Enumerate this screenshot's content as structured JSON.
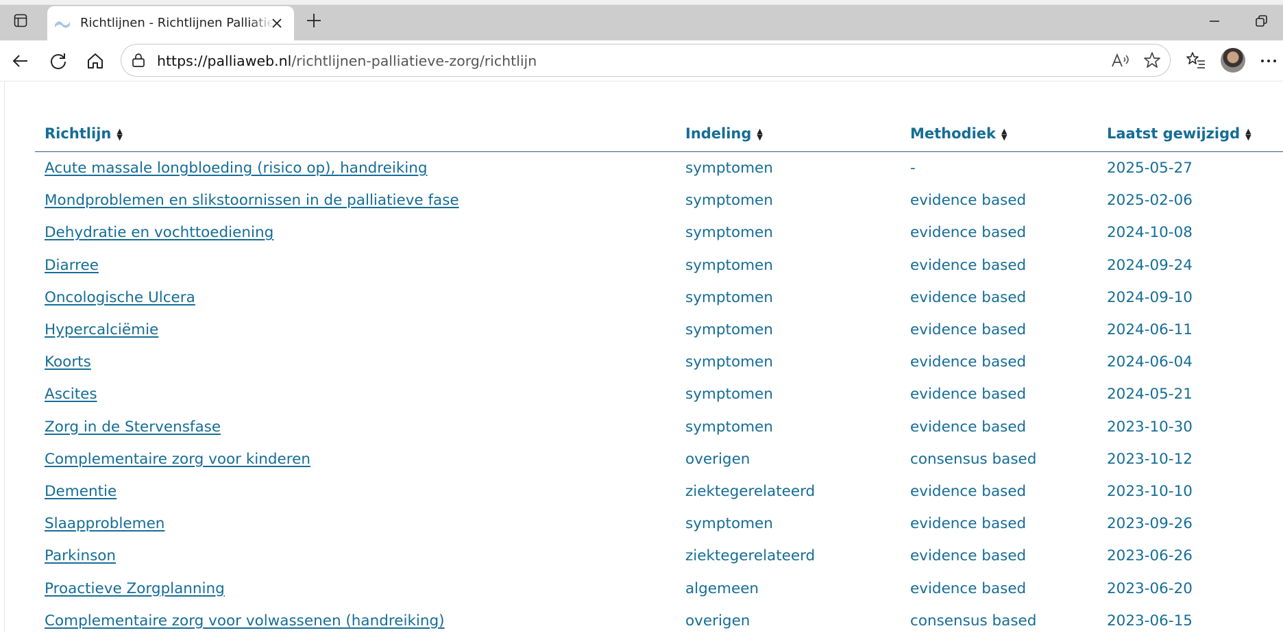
{
  "browser": {
    "tab_title": "Richtlijnen - Richtlijnen Palliatieve zorg",
    "url_host": "https://palliaweb.nl",
    "url_path": "/richtlijnen-palliatieve-zorg/richtlijn"
  },
  "table": {
    "headers": [
      "Richtlijn",
      "Indeling",
      "Methodiek",
      "Laatst gewijzigd"
    ],
    "rows": [
      {
        "name": "Acute massale longbloeding (risico op), handreiking",
        "indeling": "symptomen",
        "methodiek": "-",
        "date": "2025-05-27"
      },
      {
        "name": "Mondproblemen en slikstoornissen in de palliatieve fase",
        "indeling": "symptomen",
        "methodiek": "evidence based",
        "date": "2025-02-06"
      },
      {
        "name": "Dehydratie en vochttoediening",
        "indeling": "symptomen",
        "methodiek": "evidence based",
        "date": "2024-10-08"
      },
      {
        "name": "Diarree",
        "indeling": "symptomen",
        "methodiek": "evidence based",
        "date": "2024-09-24"
      },
      {
        "name": "Oncologische Ulcera",
        "indeling": "symptomen",
        "methodiek": "evidence based",
        "date": "2024-09-10"
      },
      {
        "name": "Hypercalciëmie",
        "indeling": "symptomen",
        "methodiek": "evidence based",
        "date": "2024-06-11"
      },
      {
        "name": "Koorts",
        "indeling": "symptomen",
        "methodiek": "evidence based",
        "date": "2024-06-04"
      },
      {
        "name": "Ascites",
        "indeling": "symptomen",
        "methodiek": "evidence based",
        "date": "2024-05-21"
      },
      {
        "name": "Zorg in de Stervensfase",
        "indeling": "symptomen",
        "methodiek": "evidence based",
        "date": "2023-10-30"
      },
      {
        "name": "Complementaire zorg voor kinderen",
        "indeling": "overigen",
        "methodiek": "consensus based",
        "date": "2023-10-12"
      },
      {
        "name": "Dementie",
        "indeling": "ziektegerelateerd",
        "methodiek": "evidence based",
        "date": "2023-10-10"
      },
      {
        "name": "Slaapproblemen",
        "indeling": "symptomen",
        "methodiek": "evidence based",
        "date": "2023-09-26"
      },
      {
        "name": "Parkinson",
        "indeling": "ziektegerelateerd",
        "methodiek": "evidence based",
        "date": "2023-06-26"
      },
      {
        "name": "Proactieve Zorgplanning",
        "indeling": "algemeen",
        "methodiek": "evidence based",
        "date": "2023-06-20"
      },
      {
        "name": "Complementaire zorg voor volwassenen (handreiking)",
        "indeling": "overigen",
        "methodiek": "consensus based",
        "date": "2023-06-15"
      }
    ]
  },
  "colors": {
    "link": "#156d96",
    "header_rule": "#2e5a8a",
    "tabbar": "#cdcdcd"
  },
  "icons": [
    "tab-actions-icon",
    "favicon-icon",
    "close-icon",
    "new-tab-icon",
    "minimize-icon",
    "restore-icon",
    "back-icon",
    "refresh-icon",
    "home-icon",
    "site-info-icon",
    "read-aloud-icon",
    "favorite-icon",
    "favorites-list-icon",
    "profile-avatar",
    "more-icon",
    "sort-icon"
  ]
}
